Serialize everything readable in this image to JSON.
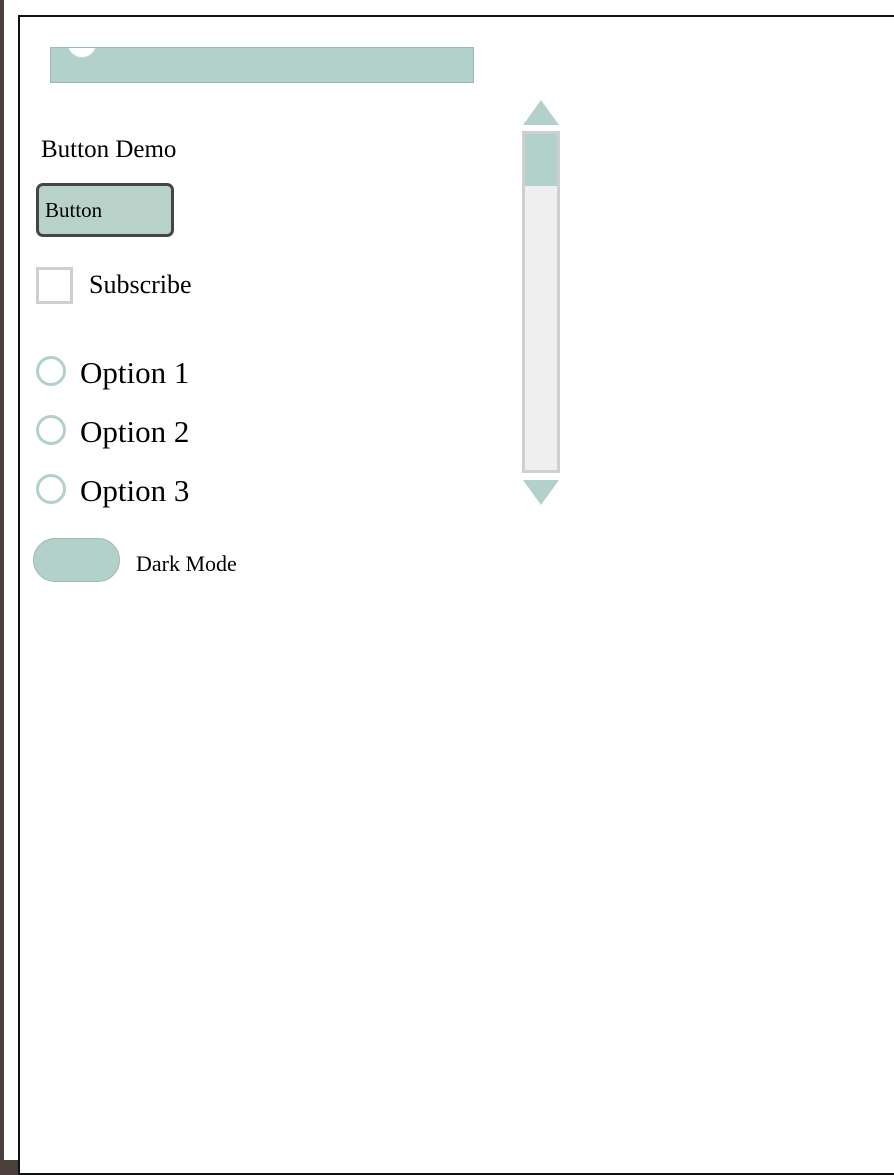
{
  "slider": {
    "value_fraction": 0.05
  },
  "demo": {
    "title": "Button Demo",
    "button_label": "Button"
  },
  "checkbox": {
    "label": "Subscribe",
    "checked": false
  },
  "radios": [
    {
      "label": "Option 1",
      "selected": false
    },
    {
      "label": "Option 2",
      "selected": false
    },
    {
      "label": "Option 3",
      "selected": false
    }
  ],
  "toggle": {
    "label": "Dark Mode",
    "on": false
  },
  "scrollbar": {
    "position_fraction": 0.0
  },
  "colors": {
    "accent": "#b3d1cb",
    "button_fill": "#b8d2ca",
    "button_border": "#454545",
    "track": "#efefef",
    "outline": "#cfcfcf",
    "page_background": "#4a3f3a"
  }
}
